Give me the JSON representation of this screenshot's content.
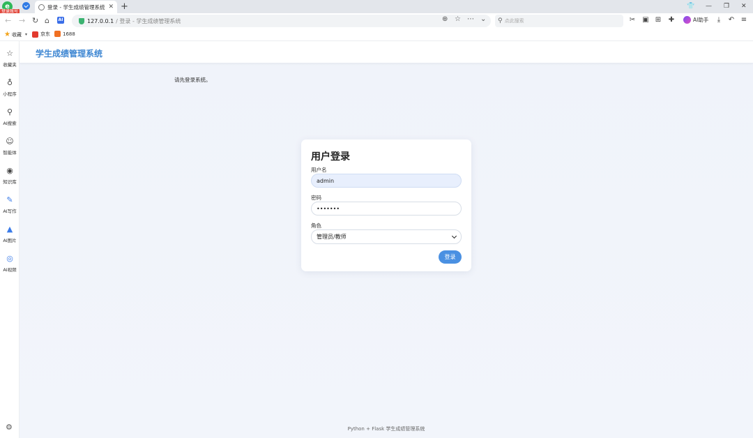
{
  "browser": {
    "badge": "登录账号",
    "tab": {
      "title": "登录 - 学生成绩管理系统"
    },
    "address": {
      "host": "127.0.0.1",
      "rest": "/ 登录 - 学生成绩管理系统"
    },
    "search": {
      "placeholder": "点此搜索"
    },
    "ai_helper": "AI助手",
    "bookmarks": [
      {
        "label": "收藏"
      },
      {
        "label": "京东"
      },
      {
        "label": "1688"
      }
    ],
    "sidebar": [
      {
        "label": "收藏夹",
        "icon": "star-icon"
      },
      {
        "label": "小程序",
        "icon": "mini-program-icon"
      },
      {
        "label": "AI搜索",
        "icon": "search-icon"
      },
      {
        "label": "智能体",
        "icon": "agent-icon"
      },
      {
        "label": "知识库",
        "icon": "knowledge-icon"
      },
      {
        "label": "AI写作",
        "icon": "pen-icon"
      },
      {
        "label": "AI图片",
        "icon": "image-icon"
      },
      {
        "label": "AI视频",
        "icon": "video-icon"
      }
    ]
  },
  "page": {
    "header_title": "学生成绩管理系统",
    "flash_message": "请先登录系统。",
    "login": {
      "title": "用户登录",
      "username_label": "用户名",
      "username_value": "admin",
      "password_label": "密码",
      "password_value": "•••••••",
      "role_label": "角色",
      "role_value": "管理员/教师",
      "submit_label": "登录"
    },
    "footer": "Python + Flask 学生成绩管理系统"
  },
  "colors": {
    "accent": "#4a90e2",
    "title_blue": "#3d86d2",
    "page_bg": "#f1f4fa"
  }
}
